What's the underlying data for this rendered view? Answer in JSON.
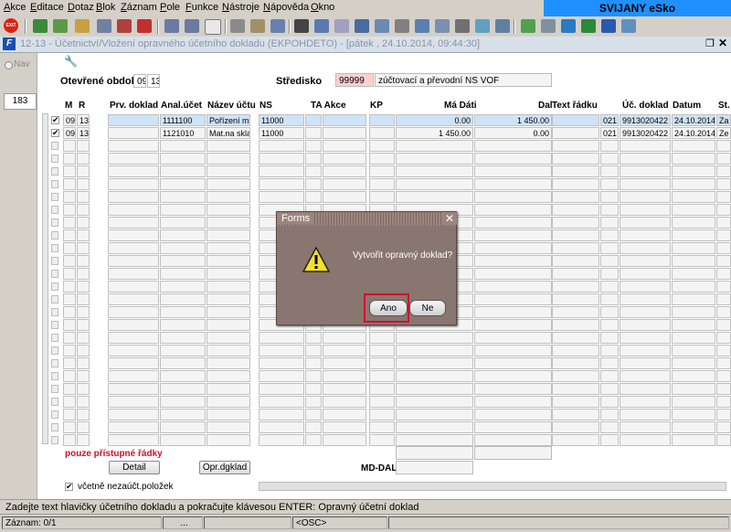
{
  "menu": [
    "Akce",
    "Editace",
    "Dotaz",
    "Blok",
    "Záznam",
    "Pole",
    "Funkce",
    "Nástroje",
    "Nápověda",
    "Okno"
  ],
  "brand": "SVIJANY eSko",
  "toolbar": {
    "exit_label": "EXIT"
  },
  "window": {
    "title": "12-13 - Účetnictví/Vložení opravného účetního dokladu (EKPOHDETO) - [pátek , 24.10.2014, 09:44:30]",
    "restore_icon": "❐",
    "close_icon": "✕"
  },
  "sidebar": {
    "nav_label": "Nav",
    "count": "183"
  },
  "header": {
    "period_label": "Otevřené období",
    "period_month": "09",
    "period_year": "13",
    "center_label": "Středisko",
    "center_code": "99999",
    "center_name": "zúčtovací a převodní NS VOF"
  },
  "grid": {
    "columns": [
      "M",
      "R",
      "Prv. doklad",
      "Anal.účet",
      "Název účtu",
      "NS",
      "TA Akce",
      "KP",
      "Má Dáti",
      "Dal",
      "Text řádku",
      "Úč. doklad",
      "Datum",
      "St."
    ],
    "rows": [
      {
        "checked": true,
        "m": "09",
        "r": "13",
        "prv": "",
        "anal": "1111100",
        "nazev": "Pořízení mat",
        "ns": "11000",
        "ta": "",
        "akce": "",
        "kp": "",
        "ma_dati": "0.00",
        "dal": "1 450.00",
        "text": "",
        "kod": "021",
        "uc_doklad": "9913020422",
        "datum": "24.10.2014",
        "st": "Za"
      },
      {
        "checked": true,
        "m": "09",
        "r": "13",
        "prv": "",
        "anal": "1121010",
        "nazev": "Mat.na sklad",
        "ns": "11000",
        "ta": "",
        "akce": "",
        "kp": "",
        "ma_dati": "1 450.00",
        "dal": "0.00",
        "text": "",
        "kod": "021",
        "uc_doklad": "9913020422",
        "datum": "24.10.2014",
        "st": "Ze"
      }
    ]
  },
  "footer": {
    "access_note": "pouze přístupné řádky",
    "detail_button": "Detail",
    "opr_button": "Opr.dgklad",
    "md_dal_label": "MD-DAL",
    "include_label": "včetně nezaúčt.položek"
  },
  "status": {
    "message": "Zadejte text hlavičky účetního dokladu a pokračujte klávesou ENTER: Opravný účetní doklad",
    "record": "Záznam: 0/1",
    "mid": "...",
    "osc": "<OSC>"
  },
  "dialog": {
    "title": "Forms",
    "close_icon": "✕",
    "message": "Vytvořit opravný doklad?",
    "icon": "warning-icon",
    "yes_button": "Ano",
    "no_button": "Ne"
  },
  "colors": {
    "brand_bg": "#1e90ff",
    "highlight": "#d0102a",
    "dialog_bg": "#8a7670",
    "access_note": "#d0102a"
  }
}
